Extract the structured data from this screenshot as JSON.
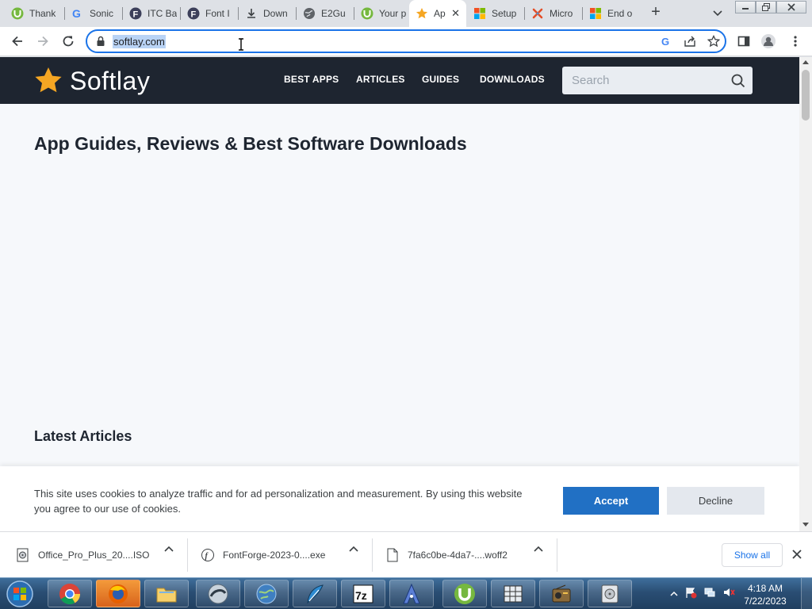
{
  "browser": {
    "tabs": [
      {
        "title": "Thank",
        "icon": "utorrent-icon"
      },
      {
        "title": "Sonic",
        "icon": "google-icon"
      },
      {
        "title": "ITC Ba",
        "icon": "fontforge-f-icon"
      },
      {
        "title": "Font I",
        "icon": "fontforge-f-icon"
      },
      {
        "title": "Down",
        "icon": "download-icon"
      },
      {
        "title": "E2Gu",
        "icon": "globe-icon"
      },
      {
        "title": "Your p",
        "icon": "utorrent-icon"
      },
      {
        "title": "Ap",
        "icon": "star-icon",
        "active": true
      },
      {
        "title": "Setup",
        "icon": "microsoft-icon"
      },
      {
        "title": "Micro",
        "icon": "joomla-icon"
      },
      {
        "title": "End o",
        "icon": "microsoft-icon"
      }
    ],
    "address": "softlay.com"
  },
  "site": {
    "brand": "Softlay",
    "nav": [
      "BEST APPS",
      "ARTICLES",
      "GUIDES",
      "DOWNLOADS"
    ],
    "search_placeholder": "Search",
    "headline": "App Guides, Reviews & Best Software Downloads",
    "latest_heading": "Latest Articles",
    "cookie": {
      "text": "This site uses cookies to analyze traffic and for ad personalization and measurement. By using this website you agree to our use of cookies.",
      "accept": "Accept",
      "decline": "Decline"
    },
    "colors": {
      "header_bg": "#1e2530",
      "accent": "#f5a623",
      "accept_bg": "#2170c4"
    }
  },
  "downloads": {
    "items": [
      {
        "name": "Office_Pro_Plus_20....ISO",
        "icon": "iso-file-icon"
      },
      {
        "name": "FontForge-2023-0....exe",
        "icon": "fontforge-file-icon"
      },
      {
        "name": "7fa6c0be-4da7-....woff2",
        "icon": "generic-file-icon"
      }
    ],
    "show_all": "Show all"
  },
  "taskbar": {
    "apps": [
      "chrome",
      "firefox",
      "file-explorer",
      "app-sphere",
      "globe-app",
      "feather-app",
      "7zip",
      "vector-app",
      "utorrent",
      "grid-app",
      "radio-app",
      "disk-app"
    ],
    "time": "4:18 AM",
    "date": "7/22/2023"
  }
}
